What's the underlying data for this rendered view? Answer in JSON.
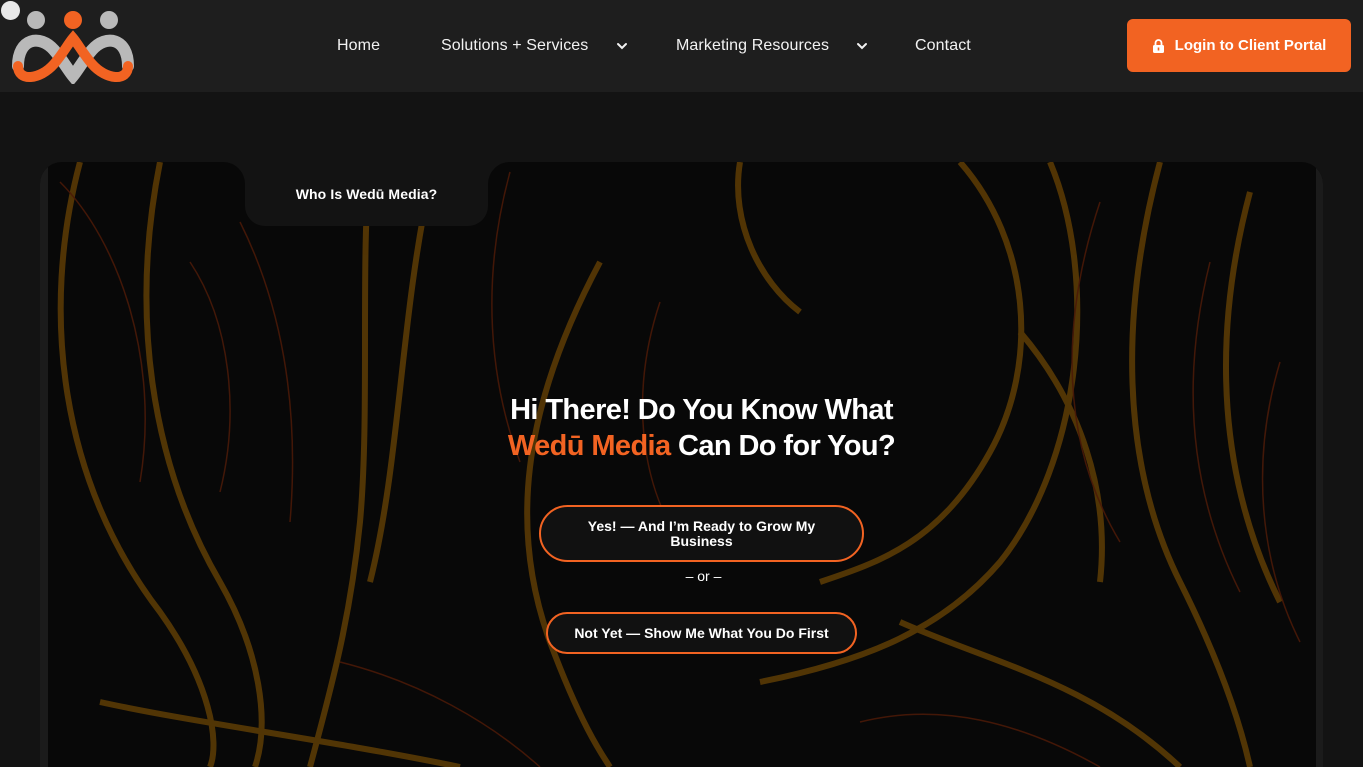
{
  "header": {
    "nav": {
      "home": "Home",
      "solutions": "Solutions + Services",
      "marketing": "Marketing Resources",
      "contact": "Contact"
    },
    "login_label": "Login to Client Portal"
  },
  "hero": {
    "tab_label": "Who Is Wedū Media?",
    "headline_line1": "Hi There! Do You Know What",
    "headline_brand": "Wedū Media",
    "headline_rest": " Can Do for You?",
    "cta_yes": "Yes! — And I’m Ready to Grow My Business",
    "or_text": "– or –",
    "cta_no": "Not Yet — Show Me What You Do First"
  },
  "colors": {
    "accent": "#f26322",
    "header_bg": "#1e1e1e",
    "page_bg": "#131313"
  },
  "icons": {
    "logo": "wedu-people-logo",
    "dropdown": "chevron-down-icon",
    "login": "lock-icon"
  }
}
